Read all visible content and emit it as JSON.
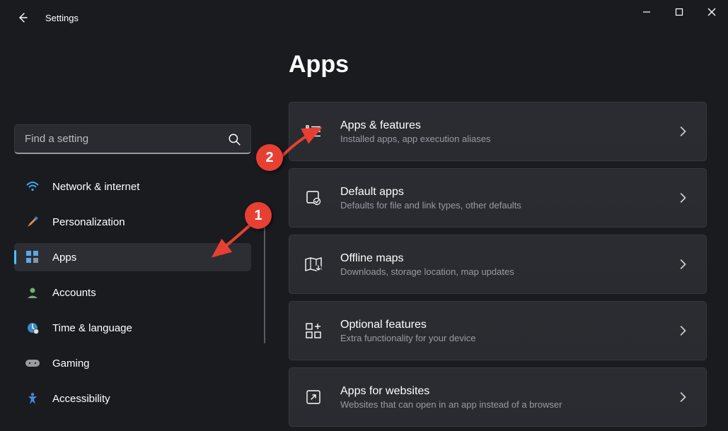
{
  "window": {
    "title": "Settings"
  },
  "search": {
    "placeholder": "Find a setting"
  },
  "sidebar": {
    "items": [
      {
        "label": "Network & internet"
      },
      {
        "label": "Personalization"
      },
      {
        "label": "Apps"
      },
      {
        "label": "Accounts"
      },
      {
        "label": "Time & language"
      },
      {
        "label": "Gaming"
      },
      {
        "label": "Accessibility"
      }
    ]
  },
  "page": {
    "heading": "Apps",
    "cards": [
      {
        "title": "Apps & features",
        "desc": "Installed apps, app execution aliases"
      },
      {
        "title": "Default apps",
        "desc": "Defaults for file and link types, other defaults"
      },
      {
        "title": "Offline maps",
        "desc": "Downloads, storage location, map updates"
      },
      {
        "title": "Optional features",
        "desc": "Extra functionality for your device"
      },
      {
        "title": "Apps for websites",
        "desc": "Websites that can open in an app instead of a browser"
      }
    ]
  },
  "annotations": {
    "badge1": "1",
    "badge2": "2"
  }
}
